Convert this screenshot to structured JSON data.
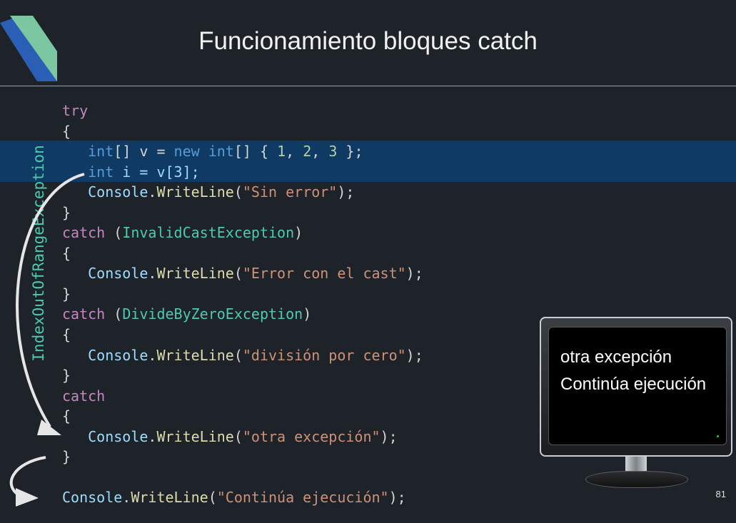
{
  "slide": {
    "title": "Funcionamiento bloques catch",
    "page_number": "81",
    "exception_label": "IndexOutOfRangeException"
  },
  "code": {
    "try": "try",
    "open": "{",
    "close": "}",
    "l_int": "int",
    "l_brackets": "[] v = ",
    "l_new": "new",
    "l_space": " ",
    "l_int2": "int",
    "l_array_open": "[] { ",
    "n1": "1",
    "comma1": ", ",
    "n2": "2",
    "comma2": ", ",
    "n3": "3",
    "l_array_close": " };",
    "i_int": "int",
    "i_rest": " i = v[3];",
    "console": "Console",
    "dot": ".",
    "writeline": "WriteLine",
    "paren_open": "(",
    "paren_close_semi": ");",
    "s_sin_error": "\"Sin error\"",
    "catch": "catch",
    "ex_invalid": "InvalidCastException",
    "ex_divide": "DivideByZeroException",
    "s_error_cast": "\"Error con el cast\"",
    "s_division": "\"división por cero\"",
    "s_otra": "\"otra excepción\"",
    "s_continua": "\"Continúa ejecución\""
  },
  "console_output": {
    "line1": "otra excepción",
    "line2": "Continúa ejecución"
  },
  "colors": {
    "keyword": "#c586c0",
    "type": "#569cd6",
    "class": "#4ec9b0",
    "string": "#ce9178",
    "number": "#b5cea8",
    "method": "#dcdcaa",
    "highlight": "#0f3a63"
  }
}
